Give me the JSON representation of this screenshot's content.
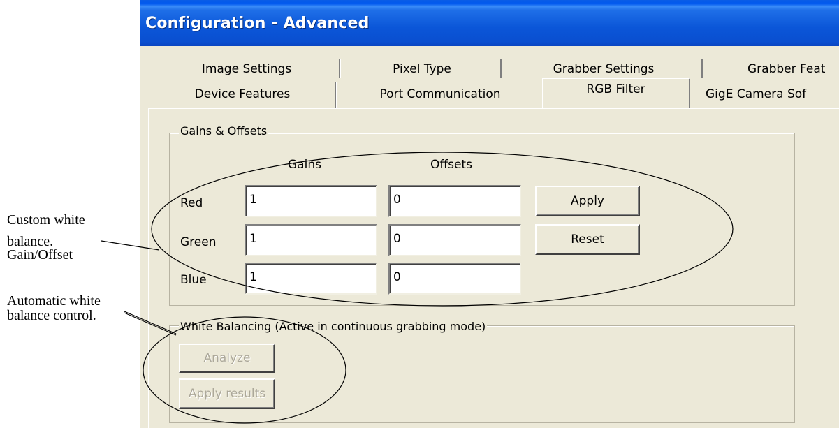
{
  "window": {
    "title": "Configuration - Advanced"
  },
  "tabs": {
    "row_back": [
      "Image Settings",
      "Pixel Type",
      "Grabber Settings",
      "Grabber Feat"
    ],
    "row_front": [
      "Device Features",
      "Port Communication",
      "RGB Filter",
      "GigE Camera Sof"
    ],
    "active": "RGB Filter"
  },
  "gains_offsets": {
    "legend": "Gains & Offsets",
    "col_gains": "Gains",
    "col_offsets": "Offsets",
    "rows": [
      {
        "label": "Red",
        "gain": "1",
        "offset": "0"
      },
      {
        "label": "Green",
        "gain": "1",
        "offset": "0"
      },
      {
        "label": "Blue",
        "gain": "1",
        "offset": "0"
      }
    ],
    "apply_label": "Apply",
    "reset_label": "Reset"
  },
  "white_balancing": {
    "legend": "White Balancing (Active in continuous grabbing mode)",
    "analyze_label": "Analyze",
    "apply_results_label": "Apply results"
  },
  "annotations": {
    "custom": [
      "Custom white",
      "balance.",
      "Gain/Offset"
    ],
    "automatic": [
      "Automatic white",
      "balance control."
    ]
  },
  "colors": {
    "title_bar": "#0a56d8",
    "window_bg": "#ece9d8",
    "disabled_text": "#aca899"
  }
}
